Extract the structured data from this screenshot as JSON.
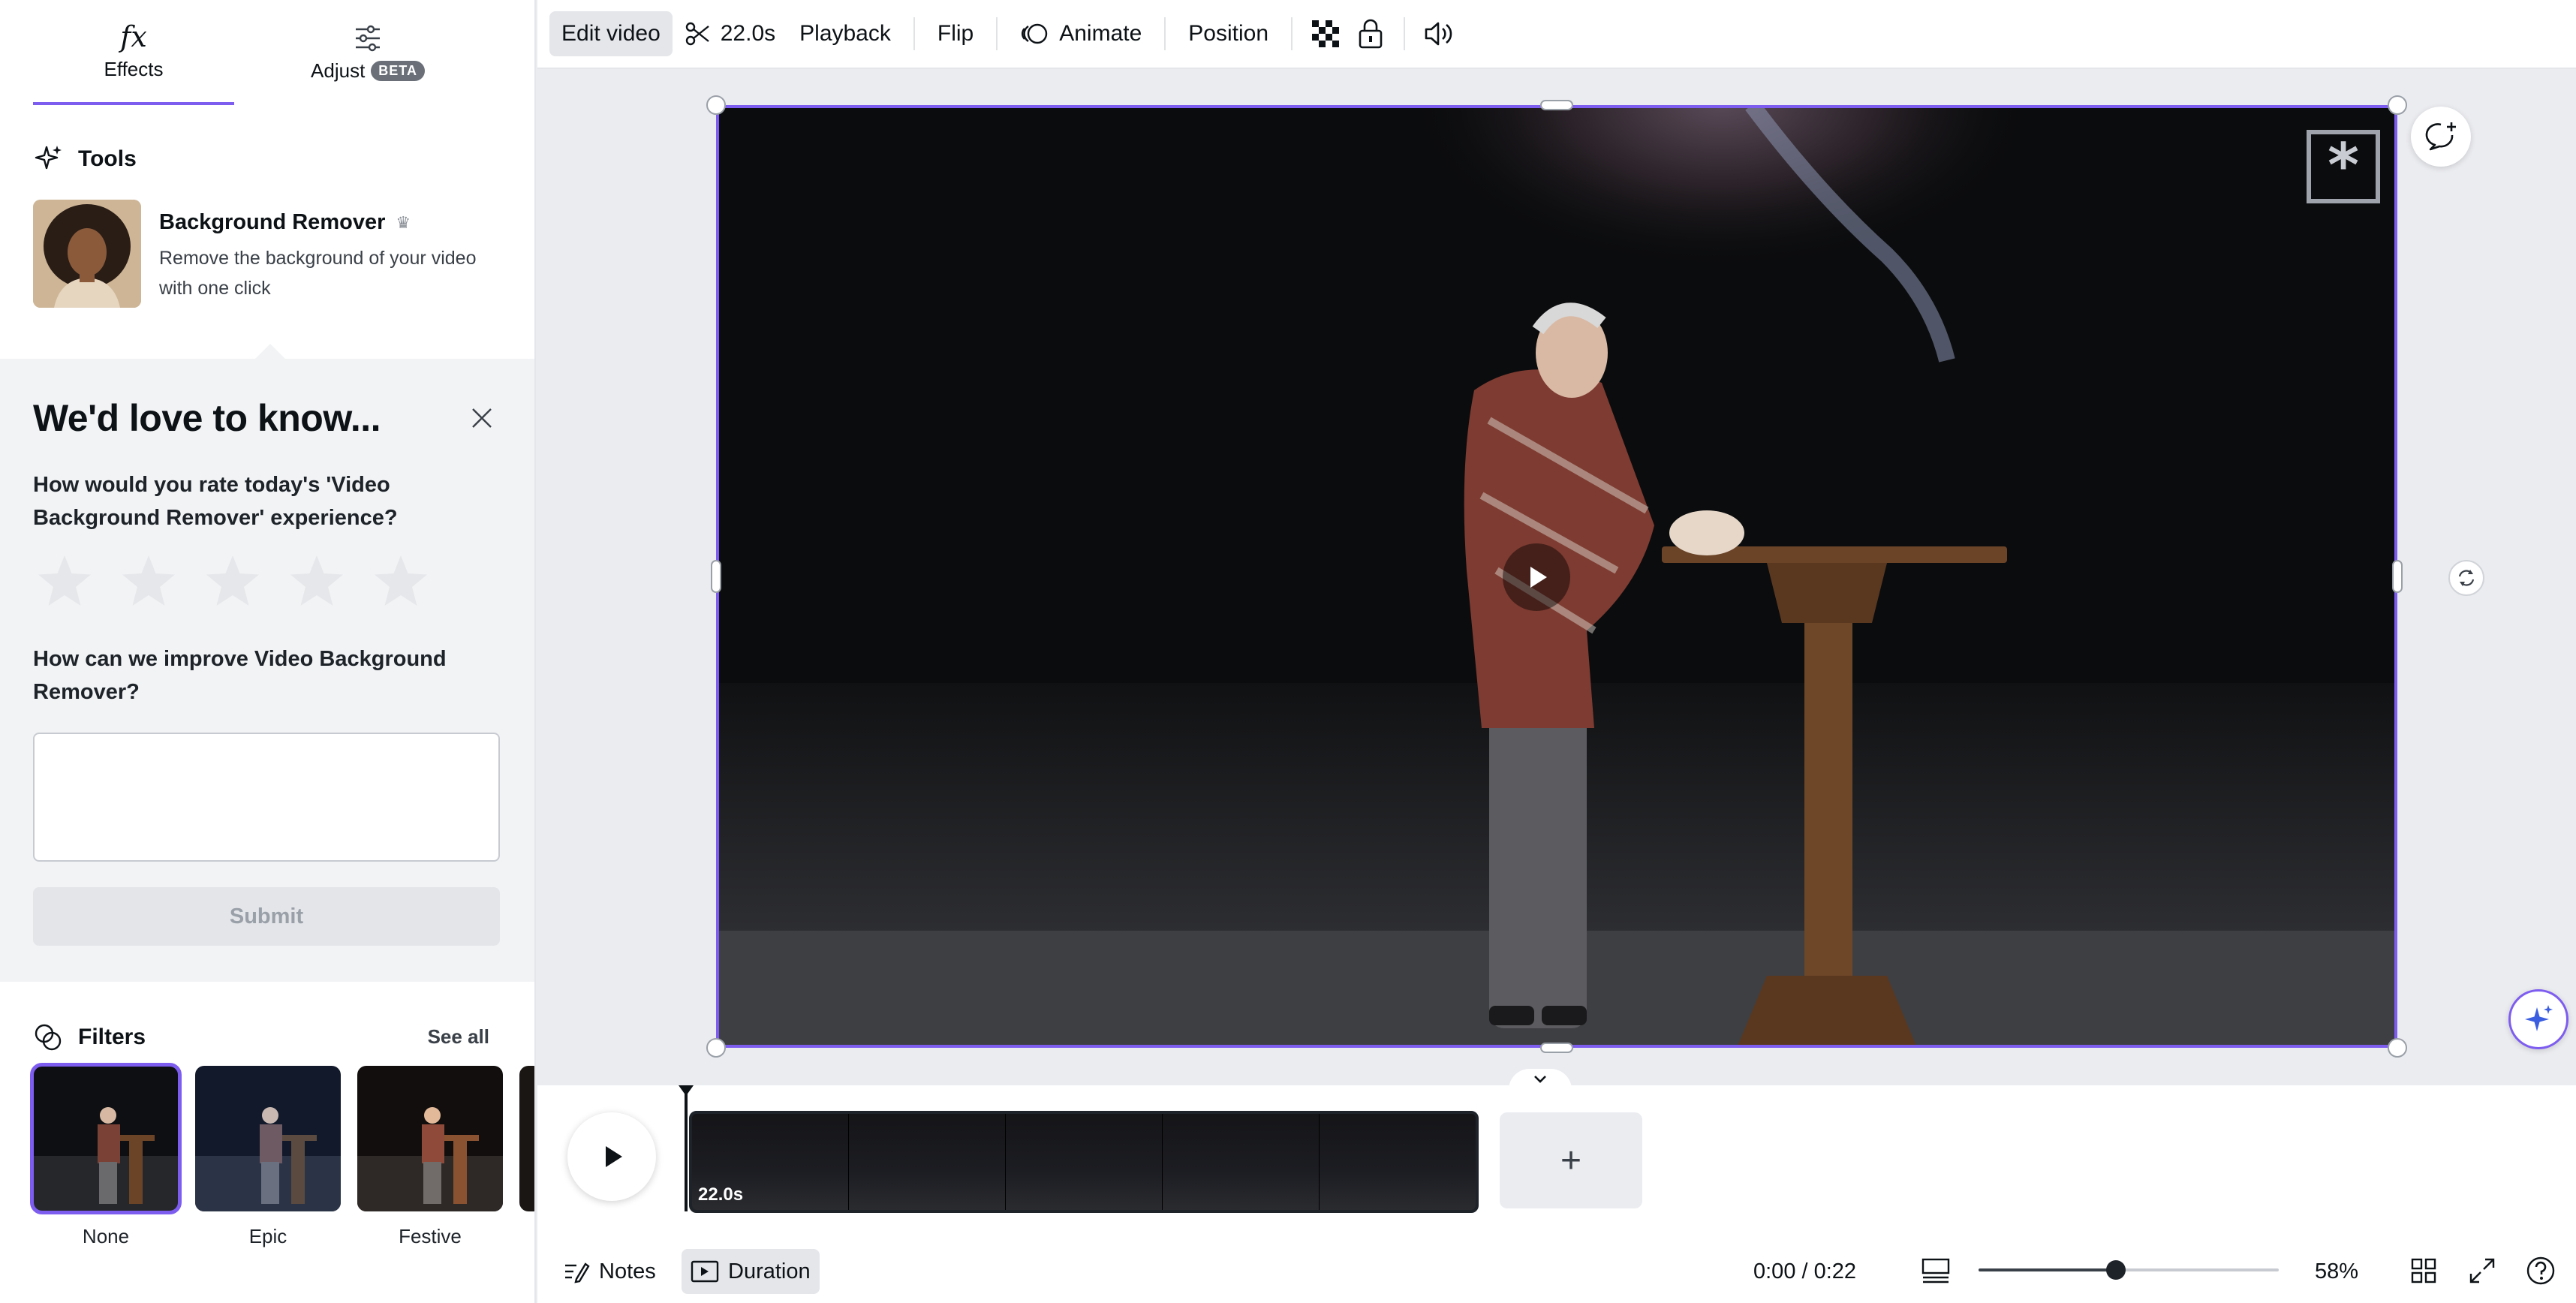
{
  "left_panel": {
    "tabs": [
      {
        "label": "Effects",
        "icon": "fx-icon",
        "active": true
      },
      {
        "label": "Adjust",
        "icon": "sliders-icon",
        "badge": "BETA",
        "active": false
      }
    ],
    "tools": {
      "heading": "Tools",
      "background_remover": {
        "title": "Background Remover",
        "description": "Remove the background of your video with one click",
        "icon": "crown-icon"
      }
    },
    "feedback": {
      "title": "We'd love to know...",
      "question_rating": "How would you rate today's 'Video Background Remover' experience?",
      "rating": 0,
      "rating_max": 5,
      "question_improve": "How can we improve Video Background Remover?",
      "text_value": "",
      "submit_label": "Submit"
    },
    "filters": {
      "heading": "Filters",
      "see_all": "See all",
      "items": [
        {
          "label": "None",
          "selected": true
        },
        {
          "label": "Epic",
          "selected": false
        },
        {
          "label": "Festive",
          "selected": false
        }
      ]
    }
  },
  "toolbar": {
    "edit_video": "Edit video",
    "trim_duration": "22.0s",
    "playback": "Playback",
    "flip": "Flip",
    "animate": "Animate",
    "position": "Position"
  },
  "timeline": {
    "clip_duration": "22.0s",
    "add_label": "+"
  },
  "bottom_bar": {
    "notes": "Notes",
    "duration": "Duration",
    "time": "0:00 / 0:22",
    "zoom_value": 58,
    "zoom_label": "58%"
  },
  "colors": {
    "accent": "#7d5cf0",
    "panel_bg": "#ffffff",
    "feedback_bg": "#f2f3f5",
    "canvas_bg": "#ebecf0"
  }
}
